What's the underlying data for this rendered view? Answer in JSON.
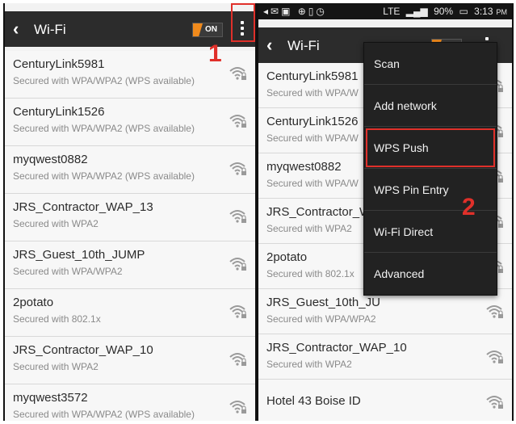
{
  "left": {
    "header": {
      "title": "Wi-Fi",
      "toggle": "ON"
    },
    "annotation": "1",
    "networks": [
      {
        "ssid": "CenturyLink5981",
        "security": "Secured with WPA/WPA2 (WPS available)"
      },
      {
        "ssid": "CenturyLink1526",
        "security": "Secured with WPA/WPA2 (WPS available)"
      },
      {
        "ssid": "myqwest0882",
        "security": "Secured with WPA/WPA2 (WPS available)"
      },
      {
        "ssid": "JRS_Contractor_WAP_13",
        "security": "Secured with WPA2"
      },
      {
        "ssid": "JRS_Guest_10th_JUMP",
        "security": "Secured with WPA/WPA2"
      },
      {
        "ssid": "2potato",
        "security": "Secured with 802.1x"
      },
      {
        "ssid": "JRS_Contractor_WAP_10",
        "security": "Secured with WPA2"
      },
      {
        "ssid": "myqwest3572",
        "security": "Secured with WPA/WPA2 (WPS available)"
      }
    ]
  },
  "right": {
    "status": {
      "left_icons": "◂✉▣ ⊕▯◷",
      "network": "LTE",
      "battery": "90%",
      "time": "3:13",
      "ampm": "PM"
    },
    "header": {
      "title": "Wi-Fi",
      "toggle": "ON"
    },
    "annotation": "2",
    "menu": [
      "Scan",
      "Add network",
      "WPS Push",
      "WPS Pin Entry",
      "Wi-Fi Direct",
      "Advanced"
    ],
    "networks": [
      {
        "ssid": "CenturyLink5981",
        "security": "Secured with WPA/W"
      },
      {
        "ssid": "CenturyLink1526",
        "security": "Secured with WPA/W"
      },
      {
        "ssid": "myqwest0882",
        "security": "Secured with WPA/W"
      },
      {
        "ssid": "JRS_Contractor_WA",
        "security": "Secured with WPA2"
      },
      {
        "ssid": "2potato",
        "security": "Secured with 802.1x"
      },
      {
        "ssid": "JRS_Guest_10th_JU",
        "security": "Secured with WPA/WPA2"
      },
      {
        "ssid": "JRS_Contractor_WAP_10",
        "security": "Secured with WPA2"
      },
      {
        "ssid": "Hotel 43 Boise ID",
        "security": ""
      }
    ]
  },
  "colors": {
    "accent": "#f08a1c",
    "annotation": "#e0302a",
    "topbar": "#2c2c2c"
  }
}
